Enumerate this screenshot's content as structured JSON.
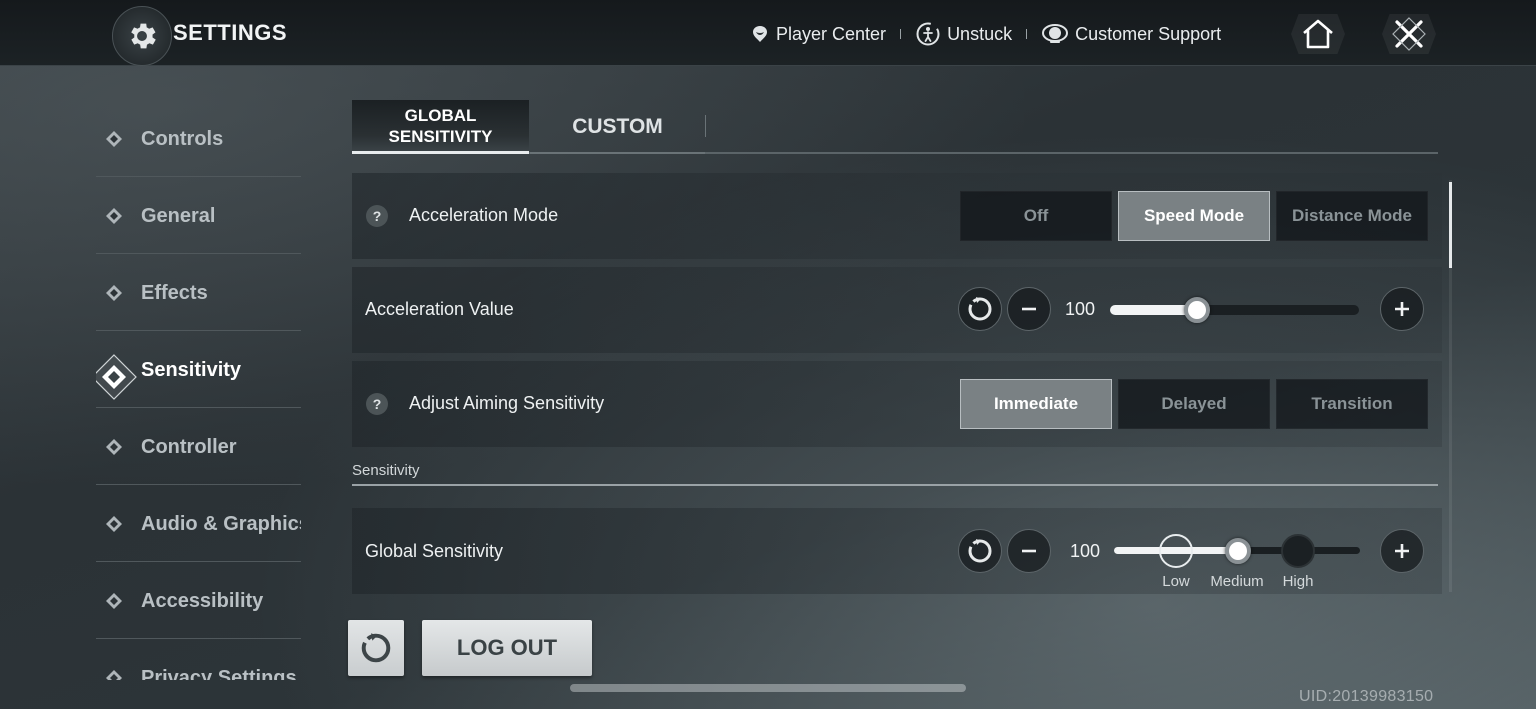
{
  "header": {
    "title": "SETTINGS",
    "links": [
      {
        "label": "Player Center",
        "icon": "player-center-icon"
      },
      {
        "label": "Unstuck",
        "icon": "unstuck-icon"
      },
      {
        "label": "Customer Support",
        "icon": "headset-icon"
      }
    ]
  },
  "sidebar": {
    "items": [
      {
        "label": "Controls",
        "active": false
      },
      {
        "label": "General",
        "active": false
      },
      {
        "label": "Effects",
        "active": false
      },
      {
        "label": "Sensitivity",
        "active": true
      },
      {
        "label": "Controller",
        "active": false
      },
      {
        "label": "Audio & Graphics",
        "active": false
      },
      {
        "label": "Accessibility",
        "active": false
      },
      {
        "label": "Privacy Settings",
        "active": false
      }
    ]
  },
  "tabs": {
    "global": "GLOBAL\nSENSITIVITY",
    "global_line1": "GLOBAL",
    "global_line2": "SENSITIVITY",
    "custom": "CUSTOM",
    "active": "global"
  },
  "rows": {
    "acceleration_mode": {
      "label": "Acceleration Mode",
      "help": "?",
      "options": [
        "Off",
        "Speed Mode",
        "Distance Mode"
      ],
      "selected": "Speed Mode"
    },
    "acceleration_value": {
      "label": "Acceleration Value",
      "value": "100",
      "level": 0.35
    },
    "adjust_aiming": {
      "label": "Adjust Aiming Sensitivity",
      "help": "?",
      "options": [
        "Immediate",
        "Delayed",
        "Transition"
      ],
      "selected": "Immediate"
    },
    "section_label": "Sensitivity",
    "global_sensitivity": {
      "label": "Global Sensitivity",
      "value": "100",
      "stops": [
        "Low",
        "Medium",
        "High"
      ],
      "selected": "Medium"
    }
  },
  "footer": {
    "logout_label": "LOG OUT",
    "uid": "UID:20139983150"
  },
  "colors": {
    "accent": "#e8ecee",
    "selected_option": "#7a8184",
    "background": "#2b3236"
  }
}
